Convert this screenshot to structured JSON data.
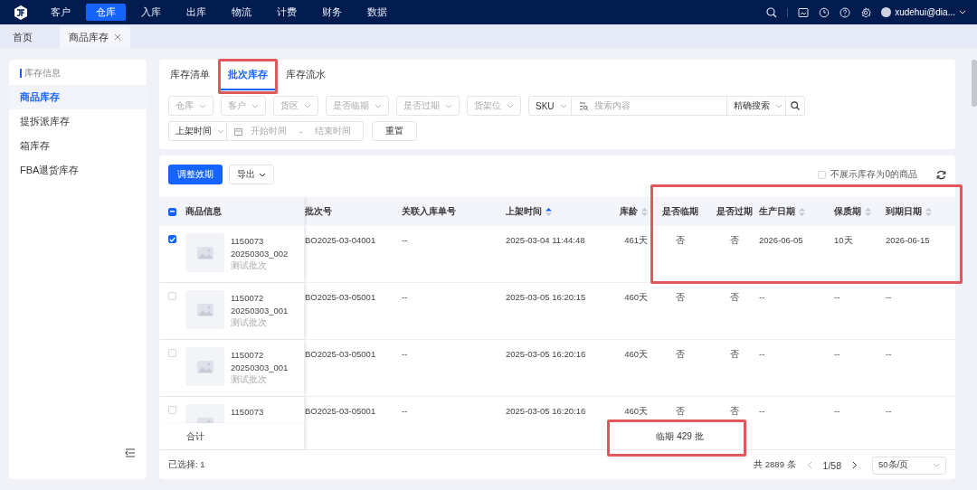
{
  "nav": {
    "items": [
      {
        "label": "客户",
        "selected": false
      },
      {
        "label": "仓库",
        "selected": true
      },
      {
        "label": "入库",
        "selected": false
      },
      {
        "label": "出库",
        "selected": false
      },
      {
        "label": "物流",
        "selected": false
      },
      {
        "label": "计费",
        "selected": false
      },
      {
        "label": "财务",
        "selected": false
      },
      {
        "label": "数据",
        "selected": false
      }
    ],
    "user": "xudehui@dia..."
  },
  "page_tabs": [
    {
      "label": "首页",
      "selected": false,
      "closable": false
    },
    {
      "label": "商品库存",
      "selected": true,
      "closable": true
    }
  ],
  "sidebar": {
    "heading": "库存信息",
    "items": [
      {
        "label": "商品库存",
        "selected": true
      },
      {
        "label": "提拆派库存",
        "selected": false
      },
      {
        "label": "箱库存",
        "selected": false
      },
      {
        "label": "FBA退货库存",
        "selected": false
      }
    ]
  },
  "inventory_tabs": [
    {
      "label": "库存清单",
      "selected": false,
      "highlighted": false
    },
    {
      "label": "批次库存",
      "selected": true,
      "highlighted": true
    },
    {
      "label": "库存流水",
      "selected": false,
      "highlighted": false
    }
  ],
  "filters": {
    "selects": [
      {
        "placeholder": "仓库"
      },
      {
        "placeholder": "客户"
      },
      {
        "placeholder": "货区"
      },
      {
        "placeholder": "是否临期"
      },
      {
        "placeholder": "是否过期"
      },
      {
        "placeholder": "货架位"
      }
    ],
    "search_field": "SKU",
    "search_placeholder": "搜索内容",
    "match_mode": "精确搜索",
    "date_field": "上架时间",
    "date_start_placeholder": "开始时间",
    "date_separator": "-",
    "date_end_placeholder": "结束时间",
    "reset": "重置"
  },
  "toolbar": {
    "primary": "调整效期",
    "export": "导出",
    "hide_zero": {
      "label": "不展示库存为0的商品",
      "checked": false
    }
  },
  "table": {
    "select_all_indeterminate": true,
    "column_frame": {
      "kind": "expiry-columns"
    },
    "columns": [
      {
        "label": "商品信息"
      },
      {
        "label": "批次号"
      },
      {
        "label": "关联入库单号"
      },
      {
        "label": "上架时间",
        "sort_ascending": true
      },
      {
        "label": "库龄",
        "sort_ascending": false
      },
      {
        "label": "是否临期"
      },
      {
        "label": "是否过期"
      },
      {
        "label": "生产日期",
        "sort_ascending": false
      },
      {
        "label": "保质期",
        "sort_ascending": false
      },
      {
        "label": "到期日期",
        "sort_ascending": false
      }
    ],
    "rows": [
      {
        "checked": true,
        "product": {
          "sku": "1150073",
          "batch_code": "20250303_002",
          "tag": "测试批次"
        },
        "batch_no": "BO2025-03-04001",
        "inbound_order": "--",
        "shelved_at": "2025-03-04 11:44:48",
        "age": "461天",
        "near_expiry": "否",
        "expired": "否",
        "production_date": "2026-06-05",
        "shelf_life": "10天",
        "expiry_date": "2026-06-15"
      },
      {
        "checked": false,
        "product": {
          "sku": "1150072",
          "batch_code": "20250303_001",
          "tag": "测试批次"
        },
        "batch_no": "BO2025-03-05001",
        "inbound_order": "--",
        "shelved_at": "2025-03-05 16:20:15",
        "age": "460天",
        "near_expiry": "否",
        "expired": "否",
        "production_date": "--",
        "shelf_life": "--",
        "expiry_date": "--"
      },
      {
        "checked": false,
        "product": {
          "sku": "1150072",
          "batch_code": "20250303_001",
          "tag": "测试批次"
        },
        "batch_no": "BO2025-03-05001",
        "inbound_order": "--",
        "shelved_at": "2025-03-05 16:20:16",
        "age": "460天",
        "near_expiry": "否",
        "expired": "否",
        "production_date": "--",
        "shelf_life": "--",
        "expiry_date": "--"
      },
      {
        "checked": false,
        "product": {
          "sku": "1150073"
        },
        "batch_no": "BO2025-03-05001",
        "inbound_order": "--",
        "shelved_at": "2025-03-05 16:20:16",
        "age": "460天",
        "near_expiry": "否",
        "expired": "否",
        "production_date": "--",
        "shelf_life": "--",
        "expiry_date": "--"
      }
    ],
    "summary": {
      "label": "合计",
      "text": "临期 429 批",
      "highlighted": true
    }
  },
  "footer": {
    "selected": "已选择: 1",
    "total": "共 2889 条",
    "page": "1/58",
    "page_size": "50条/页",
    "prev_disabled": true
  }
}
